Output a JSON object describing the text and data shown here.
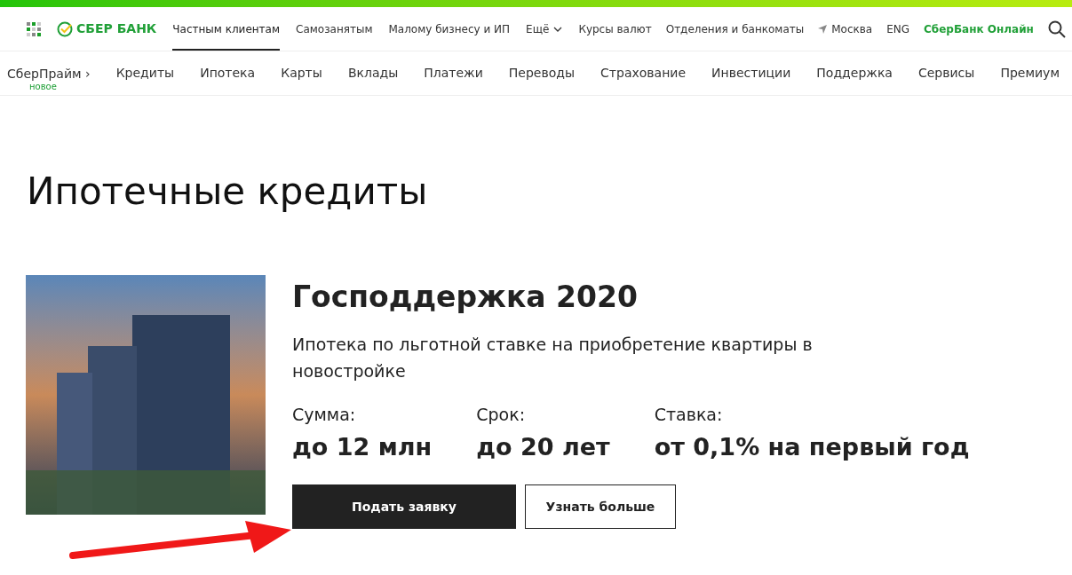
{
  "header": {
    "logo": "СБЕР БАНК",
    "segments": [
      {
        "label": "Частным клиентам",
        "selected": true
      },
      {
        "label": "Самозанятым",
        "selected": false
      },
      {
        "label": "Малому бизнесу и ИП",
        "selected": false
      },
      {
        "label": "Ещё",
        "selected": false,
        "kind": "dropdown"
      }
    ],
    "links": [
      {
        "label": "Курсы валют",
        "kind": "plain"
      },
      {
        "label": "Отделения и банкоматы",
        "kind": "plain"
      },
      {
        "label": "Москва",
        "kind": "location"
      },
      {
        "label": "ENG",
        "kind": "plain"
      },
      {
        "label": "СберБанк Онлайн",
        "kind": "accent"
      }
    ]
  },
  "menu": {
    "prime": {
      "label": "СберПрайм ›",
      "badge": "новое"
    },
    "items": [
      "Кредиты",
      "Ипотека",
      "Карты",
      "Вклады",
      "Платежи",
      "Переводы",
      "Страхование",
      "Инвестиции",
      "Поддержка",
      "Сервисы",
      "Премиум"
    ]
  },
  "page_title": "Ипотечные кредиты",
  "offer": {
    "title": "Господдержка 2020",
    "description": "Ипотека по льготной ставке на приобретение квартиры в новостройке",
    "facts": [
      {
        "label": "Сумма:",
        "value": "до 12 млн"
      },
      {
        "label": "Срок:",
        "value": "до 20 лет"
      },
      {
        "label": "Ставка:",
        "value": "от 0,1% на первый год"
      }
    ],
    "buttons": [
      {
        "label": "Подать заявку",
        "kind": "primary"
      },
      {
        "label": "Узнать больше",
        "kind": "secondary"
      }
    ]
  }
}
